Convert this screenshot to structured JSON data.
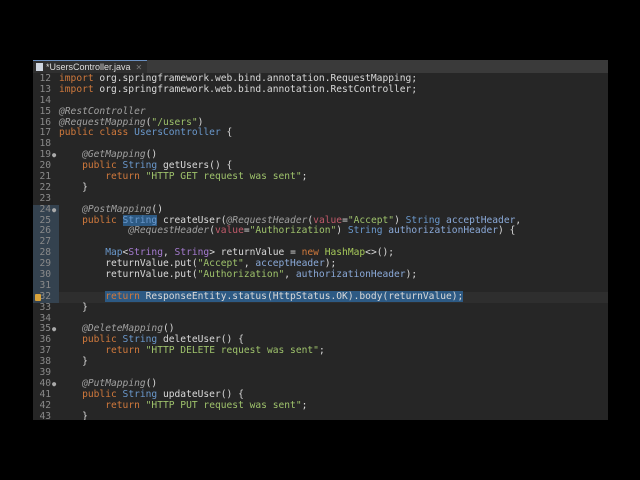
{
  "tab": {
    "title": "*UsersController.java",
    "close": "✕"
  },
  "lines": [
    {
      "n": "12",
      "t": [
        [
          "kw",
          "import"
        ],
        [
          "tx",
          " org.springframework.web.bind.annotation.RequestMapping;"
        ]
      ]
    },
    {
      "n": "13",
      "t": [
        [
          "kw",
          "import"
        ],
        [
          "tx",
          " org.springframework.web.bind.annotation.RestController;"
        ]
      ]
    },
    {
      "n": "14",
      "t": []
    },
    {
      "n": "15",
      "t": [
        [
          "an",
          "@RestController"
        ]
      ]
    },
    {
      "n": "16",
      "t": [
        [
          "an",
          "@RequestMapping"
        ],
        [
          "tx",
          "("
        ],
        [
          "st",
          "\"/users\""
        ],
        [
          "tx",
          ")"
        ]
      ]
    },
    {
      "n": "17",
      "t": [
        [
          "kw",
          "public class "
        ],
        [
          "ty",
          "UsersController"
        ],
        [
          "tx",
          " {"
        ]
      ]
    },
    {
      "n": "18",
      "t": []
    },
    {
      "n": "19",
      "m": "●",
      "t": [
        [
          "tx",
          "    "
        ],
        [
          "an",
          "@GetMapping"
        ],
        [
          "tx",
          "()"
        ]
      ]
    },
    {
      "n": "20",
      "t": [
        [
          "tx",
          "    "
        ],
        [
          "kw",
          "public "
        ],
        [
          "ty",
          "String"
        ],
        [
          "tx",
          " getUsers() {"
        ]
      ]
    },
    {
      "n": "21",
      "t": [
        [
          "tx",
          "        "
        ],
        [
          "kw",
          "return "
        ],
        [
          "st",
          "\"HTTP GET request was sent\""
        ],
        [
          "tx",
          ";"
        ]
      ]
    },
    {
      "n": "22",
      "t": [
        [
          "tx",
          "    }"
        ]
      ]
    },
    {
      "n": "23",
      "t": []
    },
    {
      "n": "24",
      "m": "●",
      "sel": true,
      "t": [
        [
          "tx",
          "    "
        ],
        [
          "an",
          "@PostMapping"
        ],
        [
          "tx",
          "()"
        ]
      ]
    },
    {
      "n": "25",
      "sel": true,
      "t": [
        [
          "tx",
          "    "
        ],
        [
          "kw",
          "public "
        ],
        [
          "ty hl",
          "String"
        ],
        [
          "tx",
          " createUser("
        ],
        [
          "an",
          "@RequestHeader"
        ],
        [
          "tx",
          "("
        ],
        [
          "pa",
          "value"
        ],
        [
          "tx",
          "="
        ],
        [
          "st",
          "\"Accept\""
        ],
        [
          "tx",
          ") "
        ],
        [
          "ty",
          "String"
        ],
        [
          "vr",
          " acceptHeader"
        ],
        [
          "tx",
          ","
        ]
      ]
    },
    {
      "n": "26",
      "sel": true,
      "t": [
        [
          "tx",
          "            "
        ],
        [
          "an",
          "@RequestHeader"
        ],
        [
          "tx",
          "("
        ],
        [
          "pa",
          "value"
        ],
        [
          "tx",
          "="
        ],
        [
          "st",
          "\"Authorization\""
        ],
        [
          "tx",
          ") "
        ],
        [
          "ty",
          "String"
        ],
        [
          "vr",
          " authorizationHeader"
        ],
        [
          "tx",
          ") {"
        ]
      ]
    },
    {
      "n": "27",
      "sel": true,
      "t": []
    },
    {
      "n": "28",
      "sel": true,
      "t": [
        [
          "tx",
          "        "
        ],
        [
          "ty",
          "Map"
        ],
        [
          "tx",
          "<"
        ],
        [
          "ge",
          "String"
        ],
        [
          "tx",
          ", "
        ],
        [
          "ge",
          "String"
        ],
        [
          "tx",
          "> returnValue = "
        ],
        [
          "kw",
          "new "
        ],
        [
          "hm",
          "HashMap"
        ],
        [
          "tx",
          "<>();"
        ]
      ]
    },
    {
      "n": "29",
      "sel": true,
      "t": [
        [
          "tx",
          "        returnValue.put("
        ],
        [
          "st",
          "\"Accept\""
        ],
        [
          "tx",
          ", "
        ],
        [
          "vr",
          "acceptHeader"
        ],
        [
          "tx",
          ");"
        ]
      ]
    },
    {
      "n": "30",
      "sel": true,
      "t": [
        [
          "tx",
          "        returnValue.put("
        ],
        [
          "st",
          "\"Authorization\""
        ],
        [
          "tx",
          ", "
        ],
        [
          "vr",
          "authorizationHeader"
        ],
        [
          "tx",
          ");"
        ]
      ]
    },
    {
      "n": "31",
      "sel": true,
      "t": []
    },
    {
      "n": "32",
      "sel": true,
      "cur": true,
      "bp": true,
      "t": [
        [
          "tx",
          "        "
        ],
        [
          "kw hl",
          "return "
        ],
        [
          "tx hl",
          "ResponseEntity.status(HttpStatus.OK).body(returnValue);"
        ]
      ]
    },
    {
      "n": "33",
      "t": [
        [
          "tx",
          "    }"
        ]
      ]
    },
    {
      "n": "34",
      "t": []
    },
    {
      "n": "35",
      "m": "●",
      "t": [
        [
          "tx",
          "    "
        ],
        [
          "an",
          "@DeleteMapping"
        ],
        [
          "tx",
          "()"
        ]
      ]
    },
    {
      "n": "36",
      "t": [
        [
          "tx",
          "    "
        ],
        [
          "kw",
          "public "
        ],
        [
          "ty",
          "String"
        ],
        [
          "tx",
          " deleteUser() {"
        ]
      ]
    },
    {
      "n": "37",
      "t": [
        [
          "tx",
          "        "
        ],
        [
          "kw",
          "return "
        ],
        [
          "st",
          "\"HTTP DELETE request was sent\""
        ],
        [
          "tx",
          ";"
        ]
      ]
    },
    {
      "n": "38",
      "t": [
        [
          "tx",
          "    }"
        ]
      ]
    },
    {
      "n": "39",
      "t": []
    },
    {
      "n": "40",
      "m": "●",
      "t": [
        [
          "tx",
          "    "
        ],
        [
          "an",
          "@PutMapping"
        ],
        [
          "tx",
          "()"
        ]
      ]
    },
    {
      "n": "41",
      "t": [
        [
          "tx",
          "    "
        ],
        [
          "kw",
          "public "
        ],
        [
          "ty",
          "String"
        ],
        [
          "tx",
          " updateUser() {"
        ]
      ]
    },
    {
      "n": "42",
      "t": [
        [
          "tx",
          "        "
        ],
        [
          "kw",
          "return "
        ],
        [
          "st",
          "\"HTTP PUT request was sent\""
        ],
        [
          "tx",
          ";"
        ]
      ]
    },
    {
      "n": "43",
      "t": [
        [
          "tx",
          "    }"
        ]
      ]
    }
  ]
}
